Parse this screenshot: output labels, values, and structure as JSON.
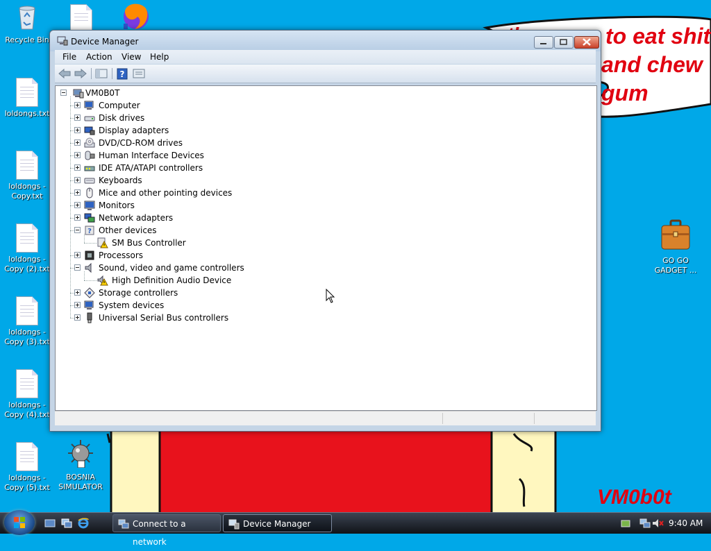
{
  "wallpaper": {
    "speech_lines": [
      "to eat shit",
      "and chew",
      "gum"
    ],
    "speech_fragment": "tl",
    "signature": "VM0b0t"
  },
  "desktop_icons": [
    {
      "label": "Recycle Bin"
    },
    {
      "label": "loldongs.txt"
    },
    {
      "label": "loldongs - Copy.txt"
    },
    {
      "label": "loldongs - Copy (2).txt"
    },
    {
      "label": "loldongs - Copy (3).txt"
    },
    {
      "label": "loldongs - Copy (4).txt"
    },
    {
      "label": "loldongs - Copy (5).txt"
    },
    {
      "label": "BOSNIA SIMULATOR"
    },
    {
      "label": "GO GO GADGET ..."
    }
  ],
  "window": {
    "title": "Device Manager",
    "menu": [
      "File",
      "Action",
      "View",
      "Help"
    ],
    "tree": {
      "root": "VM0B0T",
      "items": [
        {
          "label": "Computer",
          "icon": "computer-icon",
          "expanded": false
        },
        {
          "label": "Disk drives",
          "icon": "disk-drive-icon",
          "expanded": false
        },
        {
          "label": "Display adapters",
          "icon": "display-adapter-icon",
          "expanded": false
        },
        {
          "label": "DVD/CD-ROM drives",
          "icon": "dvd-drive-icon",
          "expanded": false
        },
        {
          "label": "Human Interface Devices",
          "icon": "hid-icon",
          "expanded": false
        },
        {
          "label": "IDE ATA/ATAPI controllers",
          "icon": "ide-controller-icon",
          "expanded": false
        },
        {
          "label": "Keyboards",
          "icon": "keyboard-icon",
          "expanded": false
        },
        {
          "label": "Mice and other pointing devices",
          "icon": "mouse-icon",
          "expanded": false
        },
        {
          "label": "Monitors",
          "icon": "monitor-icon",
          "expanded": false
        },
        {
          "label": "Network adapters",
          "icon": "network-adapter-icon",
          "expanded": false
        },
        {
          "label": "Other devices",
          "icon": "unknown-device-icon",
          "expanded": true,
          "children": [
            {
              "label": "SM Bus Controller",
              "icon": "warning-device-icon"
            }
          ]
        },
        {
          "label": "Processors",
          "icon": "processor-icon",
          "expanded": false
        },
        {
          "label": "Sound, video and game controllers",
          "icon": "speaker-icon",
          "expanded": true,
          "children": [
            {
              "label": "High Definition Audio Device",
              "icon": "warning-audio-icon"
            }
          ]
        },
        {
          "label": "Storage controllers",
          "icon": "storage-controller-icon",
          "expanded": false
        },
        {
          "label": "System devices",
          "icon": "system-device-icon",
          "expanded": false
        },
        {
          "label": "Universal Serial Bus controllers",
          "icon": "usb-icon",
          "expanded": false
        }
      ]
    }
  },
  "taskbar": {
    "tasks": [
      "Connect to a network",
      "Device Manager"
    ],
    "clock": "9:40 AM"
  }
}
